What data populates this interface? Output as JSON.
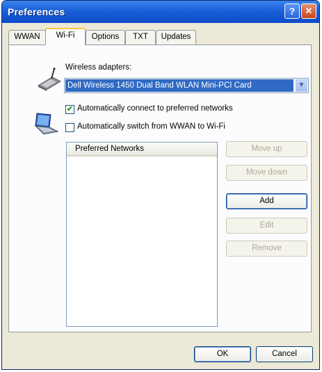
{
  "window": {
    "title": "Preferences"
  },
  "titlebar": {
    "help_glyph": "?",
    "close_glyph": "✕"
  },
  "tabs": [
    {
      "label": "WWAN",
      "active": false
    },
    {
      "label": "Wi-Fi",
      "active": true
    },
    {
      "label": "Options",
      "active": false
    },
    {
      "label": "TXT",
      "active": false
    },
    {
      "label": "Updates",
      "active": false
    }
  ],
  "wifi": {
    "adapters_label": "Wireless adapters:",
    "adapter_selected": "Dell Wireless 1450 Dual Band WLAN Mini-PCI Card",
    "auto_connect": {
      "label": "Automatically connect to preferred networks",
      "checked": true
    },
    "auto_switch": {
      "label": "Automatically switch from WWAN to Wi-Fi",
      "checked": false
    },
    "preferred_networks_header": "Preferred Networks",
    "buttons": {
      "move_up": "Move up",
      "move_down": "Move down",
      "add": "Add",
      "edit": "Edit",
      "remove": "Remove"
    }
  },
  "footer": {
    "ok": "OK",
    "cancel": "Cancel"
  },
  "icons": {
    "adapter": "wireless-card-icon",
    "laptop": "laptop-icon"
  }
}
